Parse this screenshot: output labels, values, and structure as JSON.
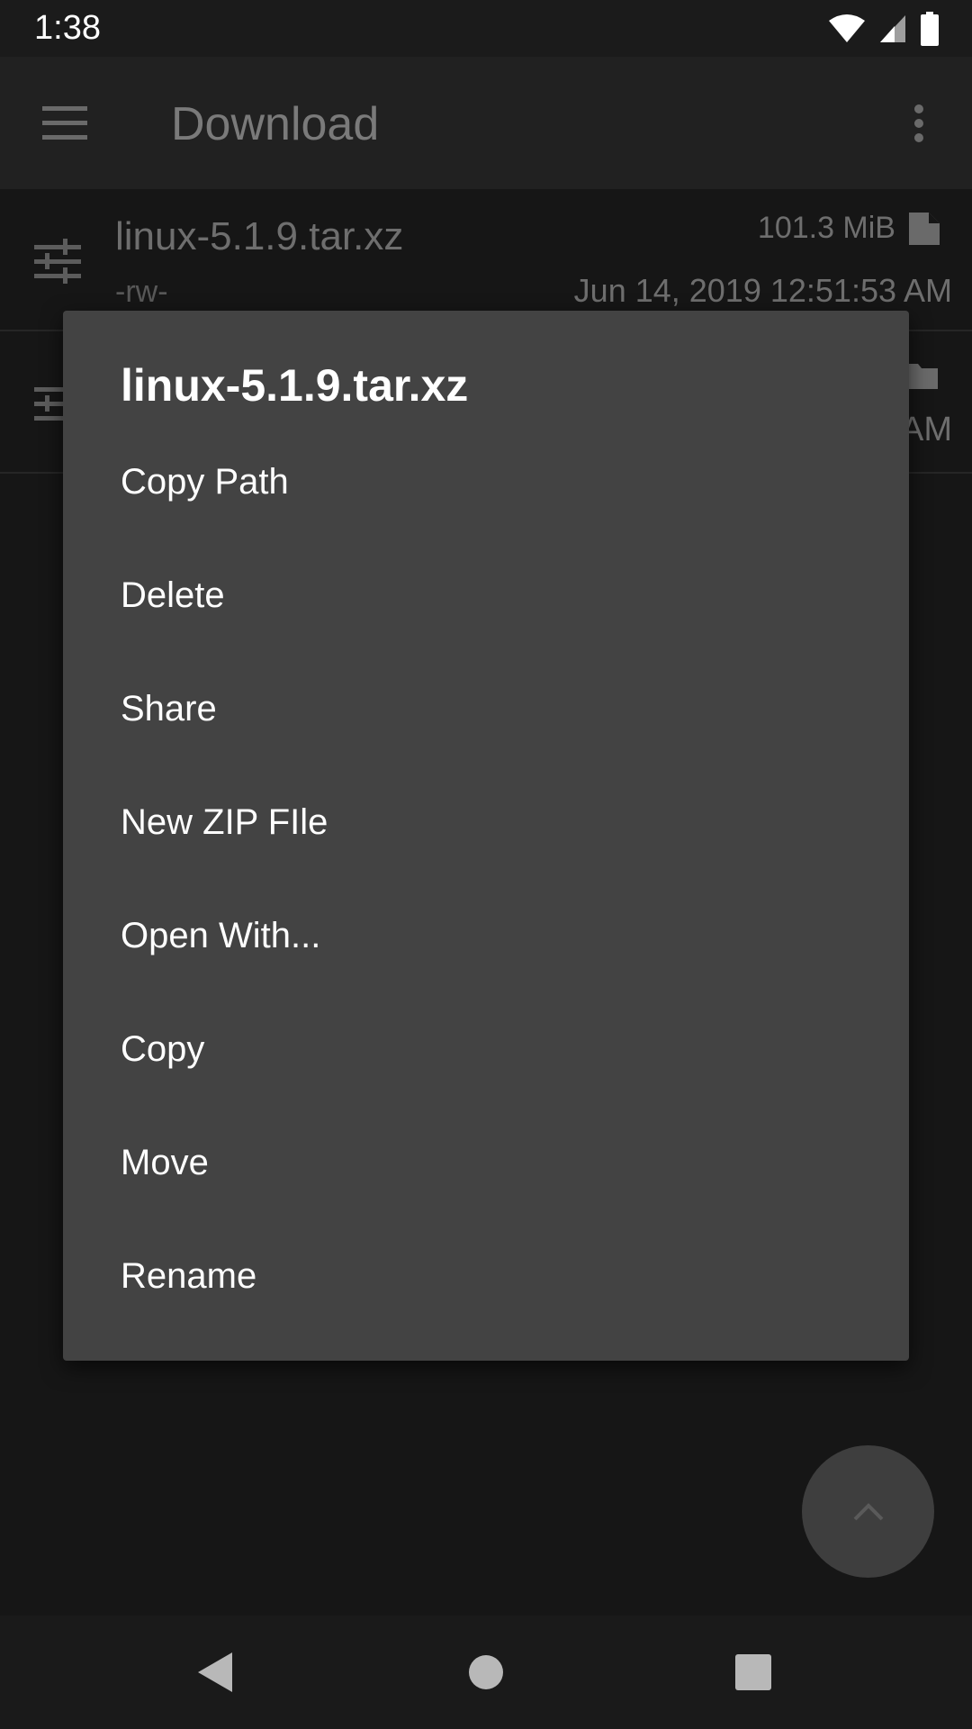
{
  "status_bar": {
    "time": "1:38",
    "icons": [
      "wifi-icon",
      "cell-signal-icon",
      "battery-icon"
    ]
  },
  "app_bar": {
    "title": "Download",
    "menu_icon": "hamburger-menu-icon",
    "overflow_icon": "more-vert-icon"
  },
  "files": [
    {
      "name": "linux-5.1.9.tar.xz",
      "permissions": "-rw-",
      "size": "101.3 MiB",
      "date": "Jun 14, 2019 12:51:53 AM",
      "type_icon": "file-icon"
    },
    {
      "name": "",
      "permissions": "",
      "size": "",
      "date": "AM",
      "type_icon": "folder-icon"
    }
  ],
  "dialog": {
    "title": "linux-5.1.9.tar.xz",
    "items": [
      {
        "label": "Copy Path"
      },
      {
        "label": "Delete"
      },
      {
        "label": "Share"
      },
      {
        "label": "New ZIP FIle"
      },
      {
        "label": "Open With..."
      },
      {
        "label": "Copy"
      },
      {
        "label": "Move"
      },
      {
        "label": "Rename"
      }
    ]
  },
  "fab": {
    "icon": "chevron-up-icon"
  },
  "nav_bar": {
    "icons": [
      "back-icon",
      "home-icon",
      "recents-icon"
    ]
  },
  "colors": {
    "dialog_bg": "#434343",
    "dim_bg": "#161616",
    "app_bar_bg": "#212121",
    "text_primary": "#ffffff"
  }
}
